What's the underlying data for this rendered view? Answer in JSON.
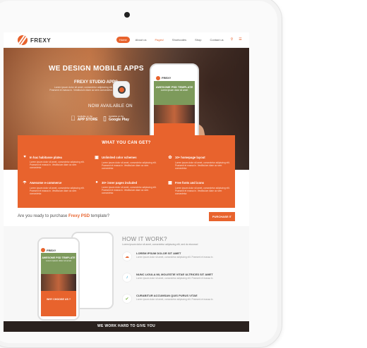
{
  "brand": {
    "name": "FREXY"
  },
  "nav": {
    "items": [
      "Home",
      "About us",
      "Pages!",
      "Shortcodes",
      "Shop",
      "Contact us"
    ],
    "search_icon": "search-icon",
    "menu_icon": "menu-icon"
  },
  "hero": {
    "headline": "WE DESIGN MOBILE APPS",
    "studio_title": "FREXY STUDIO APPS",
    "studio_desc": "Lorem ipsum dolor sit amet, consectetur adipisicing elit. Praesent et massa in. Vestibulum diam ac sem consectetur.",
    "now_available": "NOW AVAILABLE ON",
    "app_store_small": "Available on the",
    "app_store_big": "APP STORE",
    "google_small": "Available on the",
    "google_big": "Google Play",
    "phone_brand": "FREXY",
    "phone_banner_title": "AWESOME PSD TEMPLATE",
    "phone_banner_sub": "Lorem ipsum dolor sit amet"
  },
  "features": {
    "title": "WHAT YOU CAN GET?",
    "items": [
      {
        "title": "In hac habitasse platea",
        "desc": "Lorem ipsum dolor sit amet, consectetur adipiscing elit. Praesent et massa in. Vestibulum diam ac sem consectetur."
      },
      {
        "title": "Unlimited color schemes",
        "desc": "Lorem ipsum dolor sit amet, consectetur adipiscing elit. Praesent et massa in. Vestibulum diam ac sem consectetur."
      },
      {
        "title": "10+ homepage layout",
        "desc": "Lorem ipsum dolor sit amet, consectetur adipiscing elit. Praesent et massa in. Vestibulum diam ac sem consectetur."
      },
      {
        "title": "Awesome e-commerce",
        "desc": "Lorem ipsum dolor sit amet, consectetur adipiscing elit. Praesent et massa in. Vestibulum diam ac sem consectetur."
      },
      {
        "title": "30+ inner pages included",
        "desc": "Lorem ipsum dolor sit amet, consectetur adipiscing elit. Praesent et massa in. Vestibulum diam ac sem consectetur."
      },
      {
        "title": "Free fonts and icons",
        "desc": "Lorem ipsum dolor sit amet, consectetur adipiscing elit. Praesent et massa in. Vestibulum diam ac sem consectetur."
      }
    ]
  },
  "purchase": {
    "text_before": "Are you ready to purchase ",
    "text_brand": "Frexy PSD",
    "text_after": " template?",
    "button": "PURCHASE IT"
  },
  "how": {
    "title": "HOW IT WORK?",
    "subtitle": "Lorem ipsum dolor sit amet, consectetur adipiscing elit, sed do eiusmod",
    "steps": [
      {
        "title": "LOREM IPSUM DOLOR SIT AMET",
        "desc": "Lorem ipsum dolor sit amet, consectetur adipiscing elit. Praesent et massa in."
      },
      {
        "title": "NUNC LIGULA MI, MOLESTIE VITAE ULTRICES SIT AMET",
        "desc": "Lorem ipsum dolor sit amet, consectetur adipiscing elit. Praesent et massa in."
      },
      {
        "title": "CURABITUR ACCUMSAN QUIS PURUS VITAE",
        "desc": "Lorem ipsum dolor sit amet, consectetur adipiscing elit. Praesent et massa in."
      }
    ],
    "phone_brand": "FREXY",
    "phone_banner_title": "AWESOME PSD TEMPLATE",
    "phone_banner_sub": "Lorem ipsum dolor sit amet",
    "phone_bottom": "WHY CHOOSE US ?"
  },
  "band": {
    "text": "WE WORK HARD TO GIVE YOU"
  },
  "colors": {
    "accent": "#e8632d",
    "dark": "#2a211e"
  }
}
